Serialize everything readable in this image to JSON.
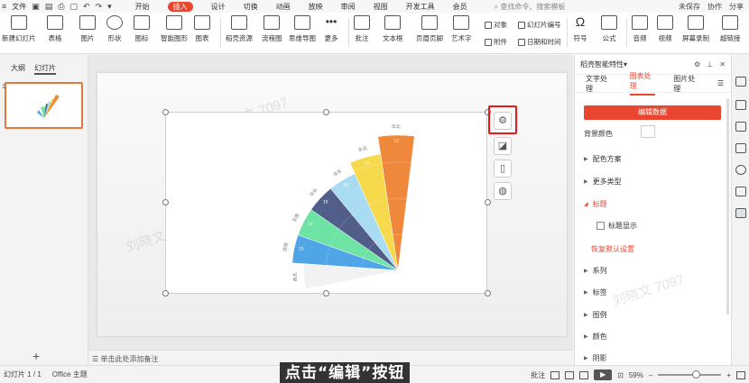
{
  "menubar": {
    "file": "文件",
    "tabs": [
      "开始",
      "插入",
      "设计",
      "切换",
      "动画",
      "放映",
      "审阅",
      "视图",
      "开发工具",
      "会员"
    ],
    "active_tab": "插入",
    "search": "查找命令、搜索模板",
    "right": [
      "未保存",
      "协作",
      "分享"
    ]
  },
  "ribbon": {
    "big": [
      {
        "label": "新建幻灯片"
      },
      {
        "label": "表格"
      },
      {
        "label": "图片"
      },
      {
        "label": "形状"
      },
      {
        "label": "图标"
      },
      {
        "label": "智能图形"
      },
      {
        "label": "图表"
      },
      {
        "label": "稻壳资源"
      },
      {
        "label": "流程图"
      },
      {
        "label": "思维导图"
      },
      {
        "label": "更多"
      },
      {
        "label": "批注"
      },
      {
        "label": "文本框"
      },
      {
        "label": "页眉页脚"
      },
      {
        "label": "艺术字"
      }
    ],
    "small": [
      "对象",
      "幻灯片编号",
      "附件",
      "日期和时间"
    ],
    "big2": [
      {
        "label": "符号"
      },
      {
        "label": "公式"
      },
      {
        "label": "音频"
      },
      {
        "label": "视频"
      },
      {
        "label": "屏幕录制"
      },
      {
        "label": "超链接"
      }
    ]
  },
  "leftpane": {
    "tabs": [
      "大纲",
      "幻灯片"
    ],
    "active": "幻灯片",
    "slide_number": "1",
    "add_icon": "plus-icon"
  },
  "chart_data": {
    "type": "pie",
    "style": "nightingale-rose",
    "categories": [
      "华北",
      "东北",
      "华东",
      "华中",
      "华南",
      "西南",
      "西北"
    ],
    "values": [
      15,
      12,
      10,
      10,
      10,
      10,
      8
    ],
    "data_labels": [
      "15",
      "12",
      "10",
      "10",
      "10",
      "10",
      "8"
    ],
    "colors": [
      "#F0883C",
      "#F7D94C",
      "#A9DCF2",
      "#525E8A",
      "#6DE3A4",
      "#4FA5E6",
      "#F2F2F2"
    ],
    "title": "",
    "legend": "none"
  },
  "sidetools": [
    "chart-elements-icon",
    "chart-style-icon",
    "filter-icon",
    "idea-icon"
  ],
  "notes": "单击此处添加备注",
  "status": {
    "slide_info": "幻灯片 1 / 1",
    "theme": "Office 主题",
    "caption": "点击“编辑”按钮",
    "comment": "批注",
    "zoom": "59%",
    "zoom_level": 0.59
  },
  "rightpane": {
    "title": "稻壳智能特性",
    "tabs": [
      "文字处理",
      "图表处理",
      "图片处理"
    ],
    "active_tab": "图表处理",
    "edit_button": "编辑数据",
    "bg_color_label": "背景颜色",
    "sections": [
      {
        "label": "配色方案",
        "expanded": false
      },
      {
        "label": "更多类型",
        "expanded": false
      },
      {
        "label": "标题",
        "expanded": true
      }
    ],
    "show_title": "标题显示",
    "reset": "恢复默认设置",
    "more_sections": [
      "系列",
      "标签",
      "图例",
      "颜色",
      "阴影"
    ]
  },
  "watermark": "刘晓文 7097"
}
